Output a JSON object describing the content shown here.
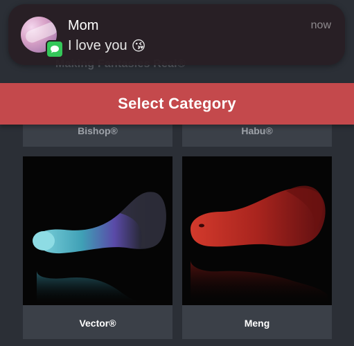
{
  "notification": {
    "sender": "Mom",
    "message": "I love you",
    "emoji": "😘",
    "time": "now",
    "app_icon": "messages-icon"
  },
  "header": {
    "tagline": "Making Fantasies Real®"
  },
  "banner": {
    "label": "Select Category",
    "color": "#c4494c"
  },
  "products": [
    {
      "name": "Bishop®"
    },
    {
      "name": "Habu®"
    },
    {
      "name": "Vector®"
    },
    {
      "name": "Meng"
    }
  ]
}
